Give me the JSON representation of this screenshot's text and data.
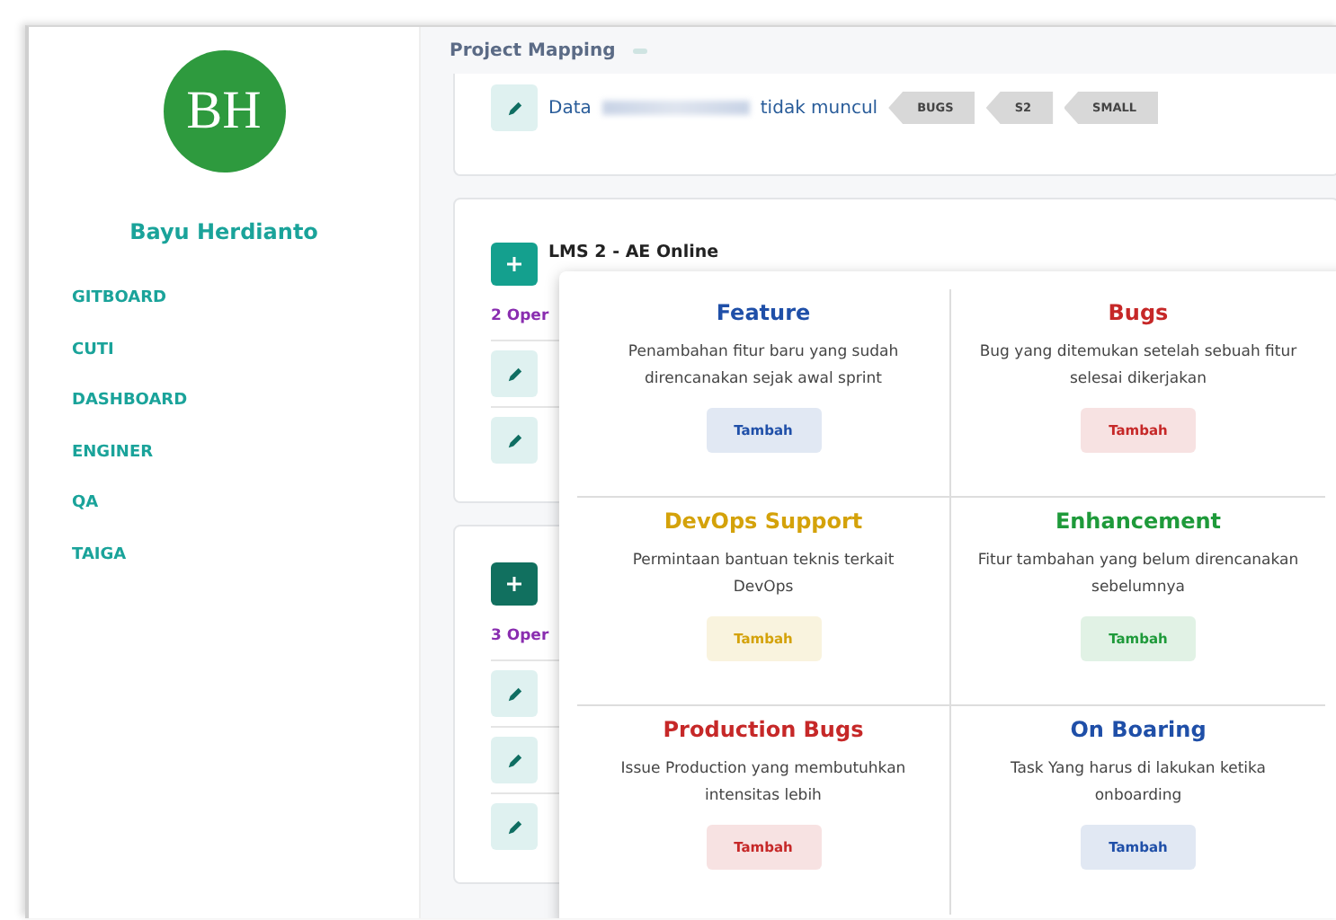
{
  "sidebar": {
    "avatar_initials": "BH",
    "user_name": "Bayu Herdianto",
    "items": [
      {
        "label": "GITBOARD"
      },
      {
        "label": "CUTI"
      },
      {
        "label": "DASHBOARD"
      },
      {
        "label": "ENGINER"
      },
      {
        "label": "QA"
      },
      {
        "label": "TAIGA"
      }
    ]
  },
  "header": {
    "title": "Project Mapping"
  },
  "cards": [
    {
      "kind": "issue",
      "rows": [
        {
          "text_before": "Data",
          "text_after": "tidak muncul",
          "tags": [
            "BUGS",
            "S2",
            "SMALL"
          ]
        }
      ]
    },
    {
      "kind": "project",
      "title": "LMS 2 - AE Online",
      "count": "2 Oper",
      "rows": [
        {
          "kind": "edit"
        },
        {
          "kind": "edit"
        }
      ]
    },
    {
      "kind": "project",
      "count": "3 Oper",
      "rows": [
        {
          "kind": "edit"
        },
        {
          "kind": "edit"
        },
        {
          "kind": "edit"
        }
      ]
    }
  ],
  "popup": {
    "categories": [
      {
        "title": "Feature",
        "color": "#1f4fa8",
        "description": "Penambahan fitur baru yang sudah direncanakan sejak awal sprint",
        "button": "Tambah"
      },
      {
        "title": "Bugs",
        "color": "#c62828",
        "description": "Bug yang ditemukan setelah sebuah fitur selesai dikerjakan",
        "button": "Tambah"
      },
      {
        "title": "DevOps Support",
        "color": "#d4a20a",
        "description": "Permintaan bantuan teknis terkait DevOps",
        "button": "Tambah"
      },
      {
        "title": "Enhancement",
        "color": "#1e9a3a",
        "description": "Fitur tambahan yang belum direncanakan sebelumnya",
        "button": "Tambah"
      },
      {
        "title": "Production Bugs",
        "color": "#c62828",
        "description": "Issue Production yang membutuhkan intensitas lebih",
        "button": "Tambah"
      },
      {
        "title": "On Boaring",
        "color": "#1f4fa8",
        "description": "Task Yang harus di lakukan ketika onboarding",
        "button": "Tambah"
      }
    ]
  }
}
